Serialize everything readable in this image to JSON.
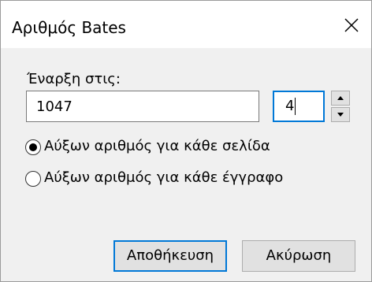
{
  "dialog": {
    "title": "Αριθμός Bates"
  },
  "start": {
    "label": "Έναρξη στις:",
    "value": "1047",
    "digits": "4"
  },
  "options": [
    {
      "label": "Αύξων αριθμός για κάθε σελίδα",
      "selected": true
    },
    {
      "label": "Αύξων αριθμός για κάθε έγγραφο",
      "selected": false
    }
  ],
  "buttons": {
    "save": "Αποθήκευση",
    "cancel": "Ακύρωση"
  },
  "icons": {
    "close": "close-icon",
    "spin_up": "triangle-up-icon",
    "spin_down": "triangle-down-icon"
  },
  "colors": {
    "accent": "#0078d7",
    "dialog_background": "#f0f0f0",
    "button_face": "#e1e1e1"
  }
}
